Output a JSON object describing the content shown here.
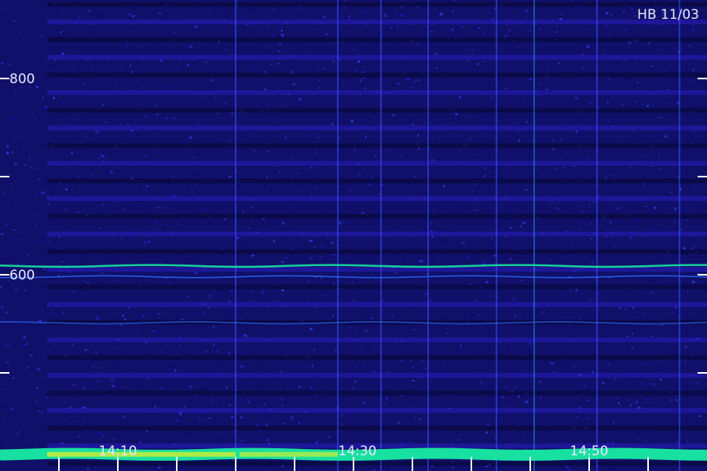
{
  "chart_data": {
    "type": "heatmap",
    "title": "HB 11/03",
    "xlabel": "",
    "ylabel": "",
    "ylim": [
      400,
      880
    ],
    "y_ticks": [
      {
        "value": 800,
        "label": "800"
      },
      {
        "value": 700,
        "label": ""
      },
      {
        "value": 600,
        "label": "600"
      },
      {
        "value": 500,
        "label": ""
      }
    ],
    "x_labels": [
      "14:10",
      "14:30",
      "14:50"
    ],
    "bright_lines": [
      {
        "name": "",
        "freq": 609,
        "intensity": 0.85
      },
      {
        "name": "",
        "freq": 598,
        "intensity": 0.6
      },
      {
        "name": "",
        "freq": 551,
        "intensity": 0.35
      },
      {
        "name": "",
        "freq": 417,
        "intensity": 1.0
      }
    ],
    "colors": {
      "background": "#10106a",
      "low": "#1a0f8c",
      "mid": "#2f6cff",
      "high": "#18e0a0",
      "peak": "#f0f020",
      "text": "#e8e8ff"
    }
  }
}
